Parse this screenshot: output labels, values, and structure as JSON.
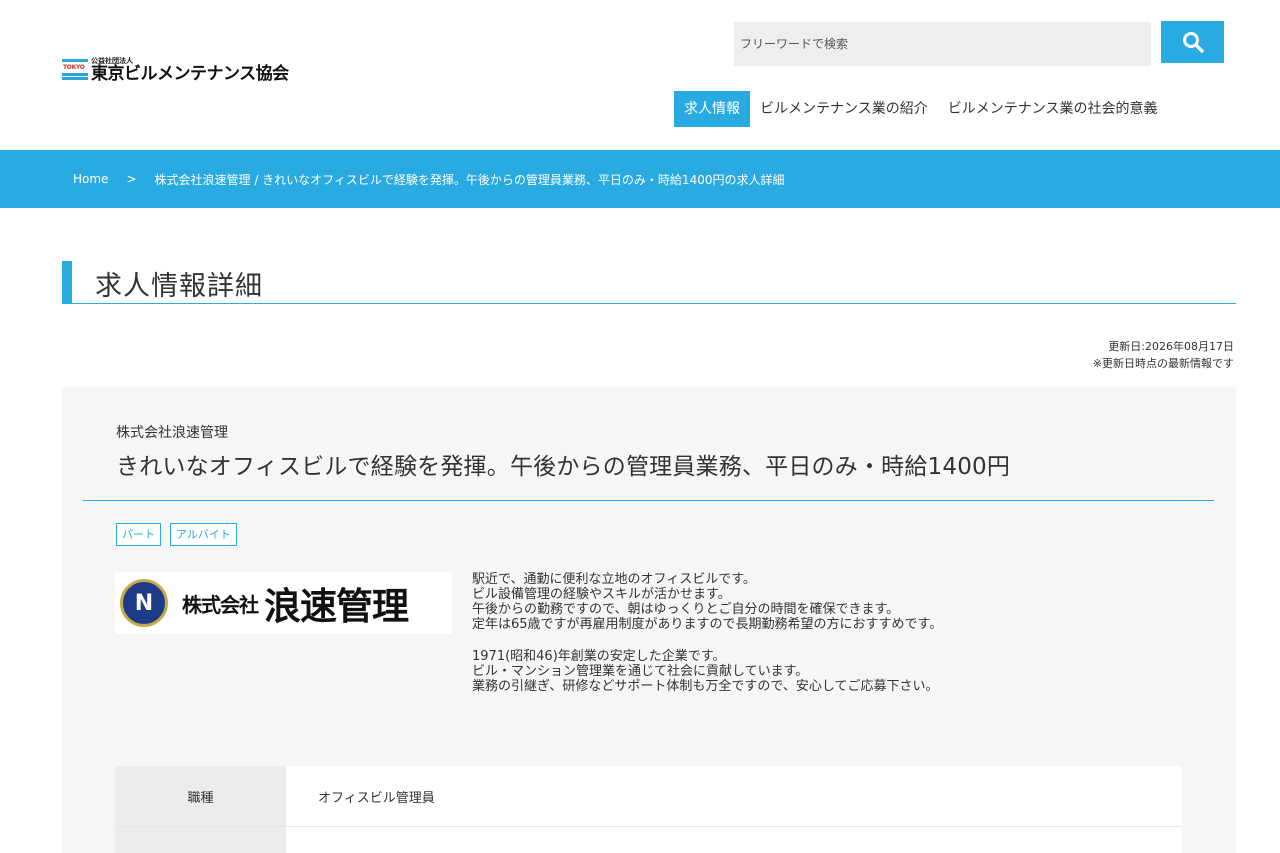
{
  "header": {
    "logo": {
      "small_text": "公益社団法人",
      "name": "東京ビルメンテナンス協会",
      "mark_text": "TOKYO"
    },
    "search": {
      "placeholder": "フリーワードで検索",
      "button_icon": "search-icon"
    },
    "nav": [
      {
        "label": "求人情報",
        "active": true
      },
      {
        "label": "ビルメンテナンス業の紹介",
        "active": false
      },
      {
        "label": "ビルメンテナンス業の社会的意義",
        "active": false
      }
    ]
  },
  "breadcrumb": {
    "home": "Home",
    "separator": ">",
    "current": "株式会社浪速管理 / きれいなオフィスビルで経験を発揮。午後からの管理員業務、平日のみ・時給1400円の求人詳細"
  },
  "page": {
    "title": "求人情報詳細",
    "updated": "更新日:2026年08月17日",
    "updated_note": "※更新日時点の最新情報です"
  },
  "job": {
    "company": "株式会社浪速管理",
    "title": "きれいなオフィスビルで経験を発揮。午後からの管理員業務、平日のみ・時給1400円",
    "tags": [
      "パート",
      "アルバイト"
    ],
    "company_logo": {
      "emblem_letter": "N",
      "prefix": "株式会社",
      "name": "浪速管理"
    },
    "description": [
      "駅近で、通勤に便利な立地のオフィスビルです。",
      "ビル設備管理の経験やスキルが活かせます。",
      "午後からの勤務ですので、朝はゆっくりとご自分の時間を確保できます。",
      "定年は65歳ですが再雇用制度がありますので長期勤務希望の方におすすめです。",
      "",
      "1971(昭和46)年創業の安定した企業です。",
      "ビル・マンション管理業を通じて社会に貢献しています。",
      "業務の引継ぎ、研修などサポート体制も万全ですので、安心してご応募下さい。"
    ],
    "details": [
      {
        "label": "職種",
        "value": "オフィスビル管理員"
      },
      {
        "label": "",
        "value": ""
      }
    ]
  },
  "colors": {
    "accent": "#29abe2",
    "card_bg": "#f6f6f6",
    "th_bg": "#ececec"
  }
}
